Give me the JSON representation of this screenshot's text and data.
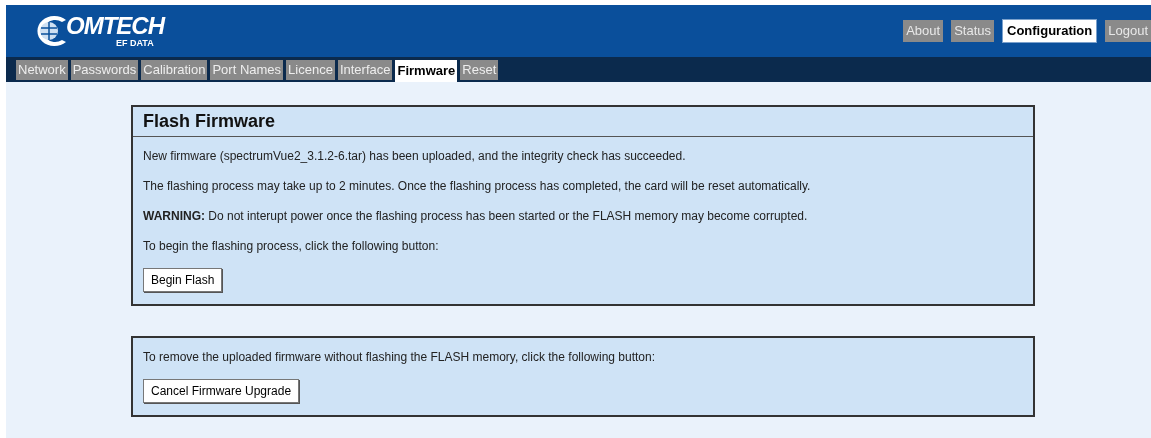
{
  "logo": {
    "name": "OMTECH",
    "sub": "EF DATA"
  },
  "top_nav": [
    {
      "label": "About",
      "selected": false
    },
    {
      "label": "Status",
      "selected": false
    },
    {
      "label": "Configuration",
      "selected": true
    },
    {
      "label": "Logout",
      "selected": false
    }
  ],
  "tabs": [
    {
      "label": "Network",
      "selected": false
    },
    {
      "label": "Passwords",
      "selected": false
    },
    {
      "label": "Calibration",
      "selected": false
    },
    {
      "label": "Port Names",
      "selected": false
    },
    {
      "label": "Licence",
      "selected": false
    },
    {
      "label": "Interface",
      "selected": false
    },
    {
      "label": "Firmware",
      "selected": true
    },
    {
      "label": "Reset",
      "selected": false
    }
  ],
  "panels": [
    {
      "title": "Flash Firmware",
      "paragraphs": [
        "New firmware (spectrumVue2_3.1.2-6.tar) has been uploaded, and the integrity check has succeeded.",
        "The flashing process may take up to 2 minutes. Once the flashing process has completed, the card will be reset automatically.",
        "**WARNING:** Do not interupt power once the flashing process has been started or the FLASH memory may become corrupted.",
        "To begin the flashing process, click the following button:"
      ],
      "button": "Begin Flash"
    },
    {
      "paragraphs": [
        "To remove the uploaded firmware without flashing the FLASH memory, click the following button:"
      ],
      "button": "Cancel Firmware Upgrade"
    }
  ]
}
